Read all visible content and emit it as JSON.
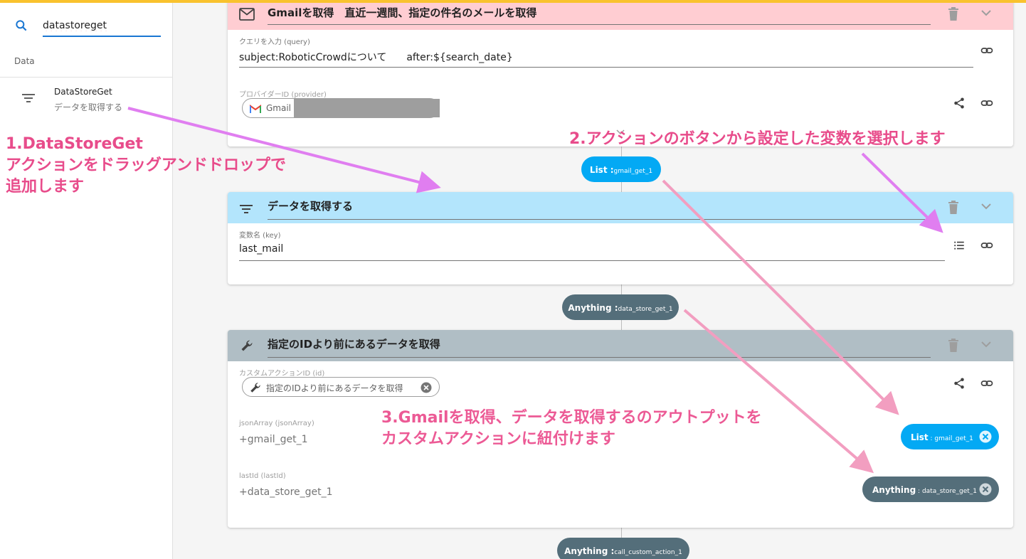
{
  "sidebar": {
    "search_value": "datastoreget",
    "section_label": "Data",
    "item": {
      "title": "DataStoreGet",
      "subtitle": "データを取得する"
    }
  },
  "cards": {
    "gmail": {
      "title": "Gmailを取得　直近一週間、指定の件名のメールを取得",
      "header_color": "#ffcdd2",
      "query_label": "クエリを入力 (query)",
      "query_value": "subject:RoboticCrowdについて　　after:${search_date}",
      "provider_label": "プロバイダーID (provider)",
      "provider_chip": "Gmail ("
    },
    "datastore": {
      "title": "データを取得する",
      "header_color": "#b3e5fc",
      "key_label": "変数名 (key)",
      "key_value": "last_mail"
    },
    "custom": {
      "title": "指定のIDより前にあるデータを取得",
      "header_color": "#b0bec5",
      "id_label": "カスタムアクションID (id)",
      "id_chip": "指定のIDより前にあるデータを取得",
      "json_label": "jsonArray (jsonArray)",
      "json_value": "+gmail_get_1",
      "lastid_label": "lastId (lastId)",
      "lastid_value": "+data_store_get_1"
    }
  },
  "outputs": {
    "gmail": {
      "type": "List :",
      "name": "gmail_get_1"
    },
    "datastore": {
      "type": "Anything :",
      "name": "data_store_get_1"
    },
    "custom": {
      "type": "Anything :",
      "name": "call_custom_action_1"
    }
  },
  "bound": {
    "json": {
      "type": "List",
      "name": " : gmail_get_1"
    },
    "lastid": {
      "type": "Anything",
      "name": " : data_store_get_1"
    }
  },
  "annotations": {
    "step1": [
      "1.DataStoreGet",
      "アクションをドラッグアンドドロップで",
      "追加します"
    ],
    "step2": "2.アクションのボタンから設定した変数を選択します",
    "step3": [
      "3.Gmailを取得、データを取得するのアウトプットを",
      "カスタムアクションに紐付けます"
    ],
    "color_purple": "#e07ef0",
    "color_pink": "#f29ec0"
  },
  "colors": {
    "accent": "#f9c22e",
    "list_pill": "#03a9f4",
    "anything_pill": "#546e7a",
    "annotation_text": "#e84c8b"
  }
}
